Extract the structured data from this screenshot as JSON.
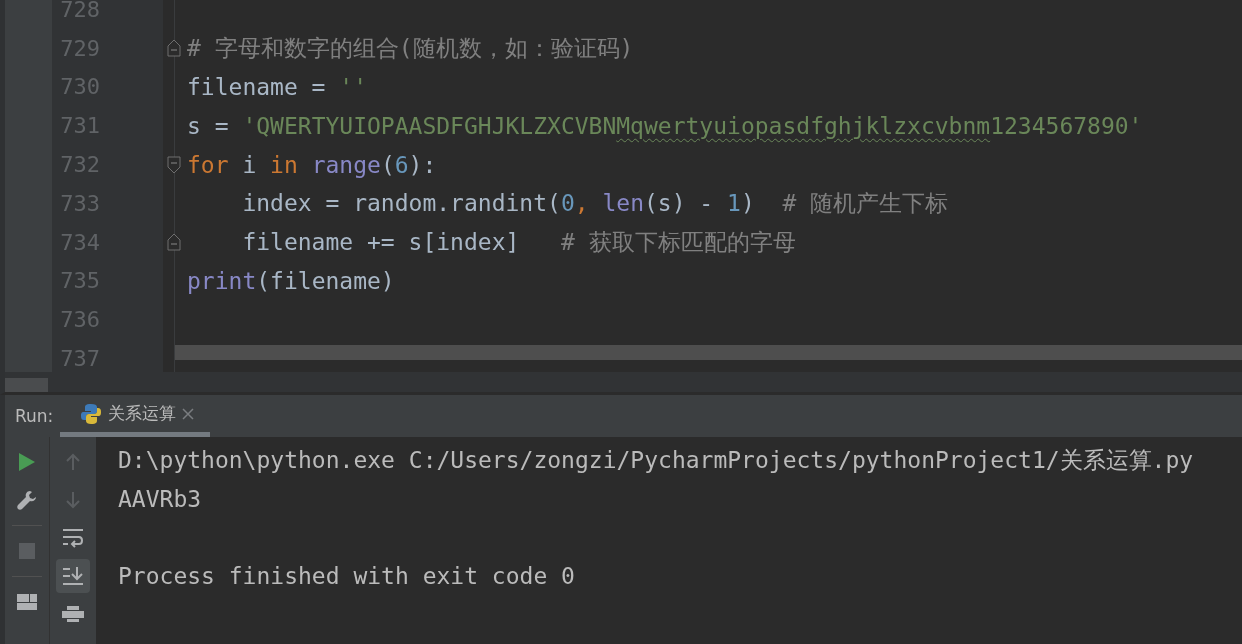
{
  "editor": {
    "lines": [
      {
        "number": "728",
        "kind": "plain"
      },
      {
        "number": "729",
        "kind": "fold-close",
        "tokens": [
          {
            "kind": "comment",
            "text": "# 字母和数字的组合(随机数，如：验证码)"
          }
        ]
      },
      {
        "number": "730",
        "kind": "plain",
        "tokens": [
          {
            "kind": "plain",
            "text": "filename = "
          },
          {
            "kind": "string",
            "text": "''"
          }
        ]
      },
      {
        "number": "731",
        "kind": "plain",
        "tokens": [
          {
            "kind": "plain",
            "text": "s = "
          },
          {
            "kind": "string",
            "text": "'QWERTYUIOPAASDFGHJKLZXCVBN"
          },
          {
            "kind": "string",
            "text": "Mqwertyuiopasdfghjklzxcvbnm",
            "typo": true
          },
          {
            "kind": "string",
            "text": "1234567890'"
          }
        ]
      },
      {
        "number": "732",
        "kind": "fold-open",
        "tokens": [
          {
            "kind": "keyword",
            "text": "for"
          },
          {
            "kind": "plain",
            "text": " i "
          },
          {
            "kind": "keyword",
            "text": "in"
          },
          {
            "kind": "builtin",
            "text": " range"
          },
          {
            "kind": "plain",
            "text": "("
          },
          {
            "kind": "number",
            "text": "6"
          },
          {
            "kind": "plain",
            "text": "):"
          }
        ]
      },
      {
        "number": "733",
        "kind": "plain",
        "tokens": [
          {
            "kind": "plain",
            "text": "    index = random.randint("
          },
          {
            "kind": "number",
            "text": "0"
          },
          {
            "kind": "keyword",
            "text": ", "
          },
          {
            "kind": "builtin",
            "text": "len"
          },
          {
            "kind": "plain",
            "text": "(s) - "
          },
          {
            "kind": "number",
            "text": "1"
          },
          {
            "kind": "plain",
            "text": ")  "
          },
          {
            "kind": "comment",
            "text": "# 随机产生下标"
          }
        ]
      },
      {
        "number": "734",
        "kind": "fold-close",
        "tokens": [
          {
            "kind": "plain",
            "text": "    filename += s[index]   "
          },
          {
            "kind": "comment",
            "text": "# 获取下标匹配的字母"
          }
        ]
      },
      {
        "number": "735",
        "kind": "plain",
        "tokens": [
          {
            "kind": "builtin",
            "text": "print"
          },
          {
            "kind": "plain",
            "text": "(filename)"
          }
        ]
      },
      {
        "number": "736",
        "kind": "plain"
      },
      {
        "number": "737",
        "kind": "plain"
      }
    ]
  },
  "run_panel": {
    "label": "Run:",
    "tabs": [
      {
        "label": "关系运算",
        "selected": true
      }
    ],
    "left_toolbar": [
      {
        "kind": "run",
        "disabled": false
      },
      {
        "kind": "wrench",
        "disabled": false
      },
      {
        "kind": "stop",
        "disabled": true
      },
      {
        "kind": "layout",
        "disabled": false
      }
    ],
    "right_toolbar": [
      {
        "kind": "up",
        "disabled": true,
        "selected": false
      },
      {
        "kind": "down",
        "disabled": true,
        "selected": false
      },
      {
        "kind": "wrap",
        "disabled": false,
        "selected": false
      },
      {
        "kind": "scroll-end",
        "disabled": false,
        "selected": true
      },
      {
        "kind": "print",
        "disabled": false,
        "selected": false
      }
    ],
    "console": {
      "lines": [
        "D:\\python\\python.exe C:/Users/zongzi/PycharmProjects/pythonProject1/关系运算.py",
        "AAVRb3"
      ],
      "exit_message": "Process finished with exit code 0"
    }
  }
}
